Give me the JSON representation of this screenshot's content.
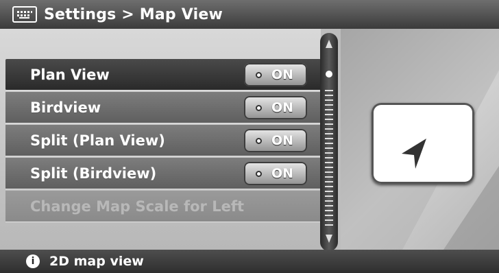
{
  "header": {
    "title": "Settings > Map View",
    "icon": "keyboard-icon"
  },
  "menu": {
    "items": [
      {
        "label": "Plan View",
        "toggle": "ON"
      },
      {
        "label": "Birdview",
        "toggle": "ON"
      },
      {
        "label": "Split (Plan View)",
        "toggle": "ON"
      },
      {
        "label": "Split (Birdview)",
        "toggle": "ON"
      },
      {
        "label": "Change Map Scale for Left"
      }
    ]
  },
  "footer": {
    "text": "2D map view",
    "icon": "info-icon"
  }
}
